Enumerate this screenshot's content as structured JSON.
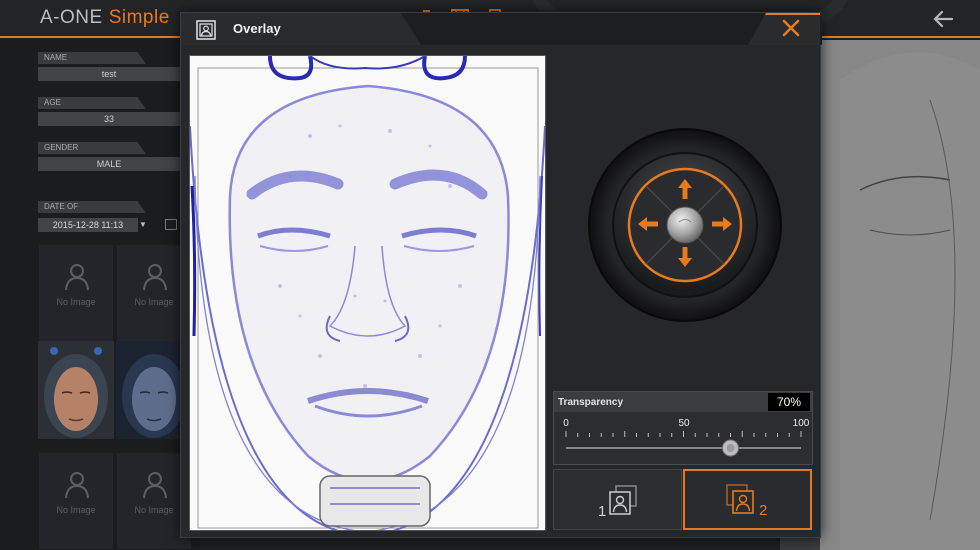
{
  "app": {
    "brand_main": "A-ONE",
    "brand_sub": "Simple"
  },
  "patient": {
    "name_label": "NAME",
    "name_value": "test",
    "age_label": "AGE",
    "age_value": "33",
    "gender_label": "GENDER",
    "gender_value": "MALE",
    "date_label": "DATE OF",
    "date_value": "2015-12-28 11:13"
  },
  "thumbnails": {
    "no_image_text": "No Image"
  },
  "dialog": {
    "title": "Overlay",
    "icons": {
      "title": "overlay-icon",
      "close": "close-icon",
      "up": "arrow-up-icon",
      "down": "arrow-down-icon",
      "left": "arrow-left-icon",
      "right": "arrow-right-icon"
    }
  },
  "transparency": {
    "label": "Transparency",
    "value_text": "70%",
    "value": 70,
    "min_label": "0",
    "mid_label": "50",
    "max_label": "100"
  },
  "modes": {
    "image1_label": "1",
    "image2_label": "2",
    "selected": 2
  },
  "colors": {
    "accent": "#e87a1e",
    "dialog_bg": "#26272b",
    "header_bg": "#1d1e21"
  }
}
